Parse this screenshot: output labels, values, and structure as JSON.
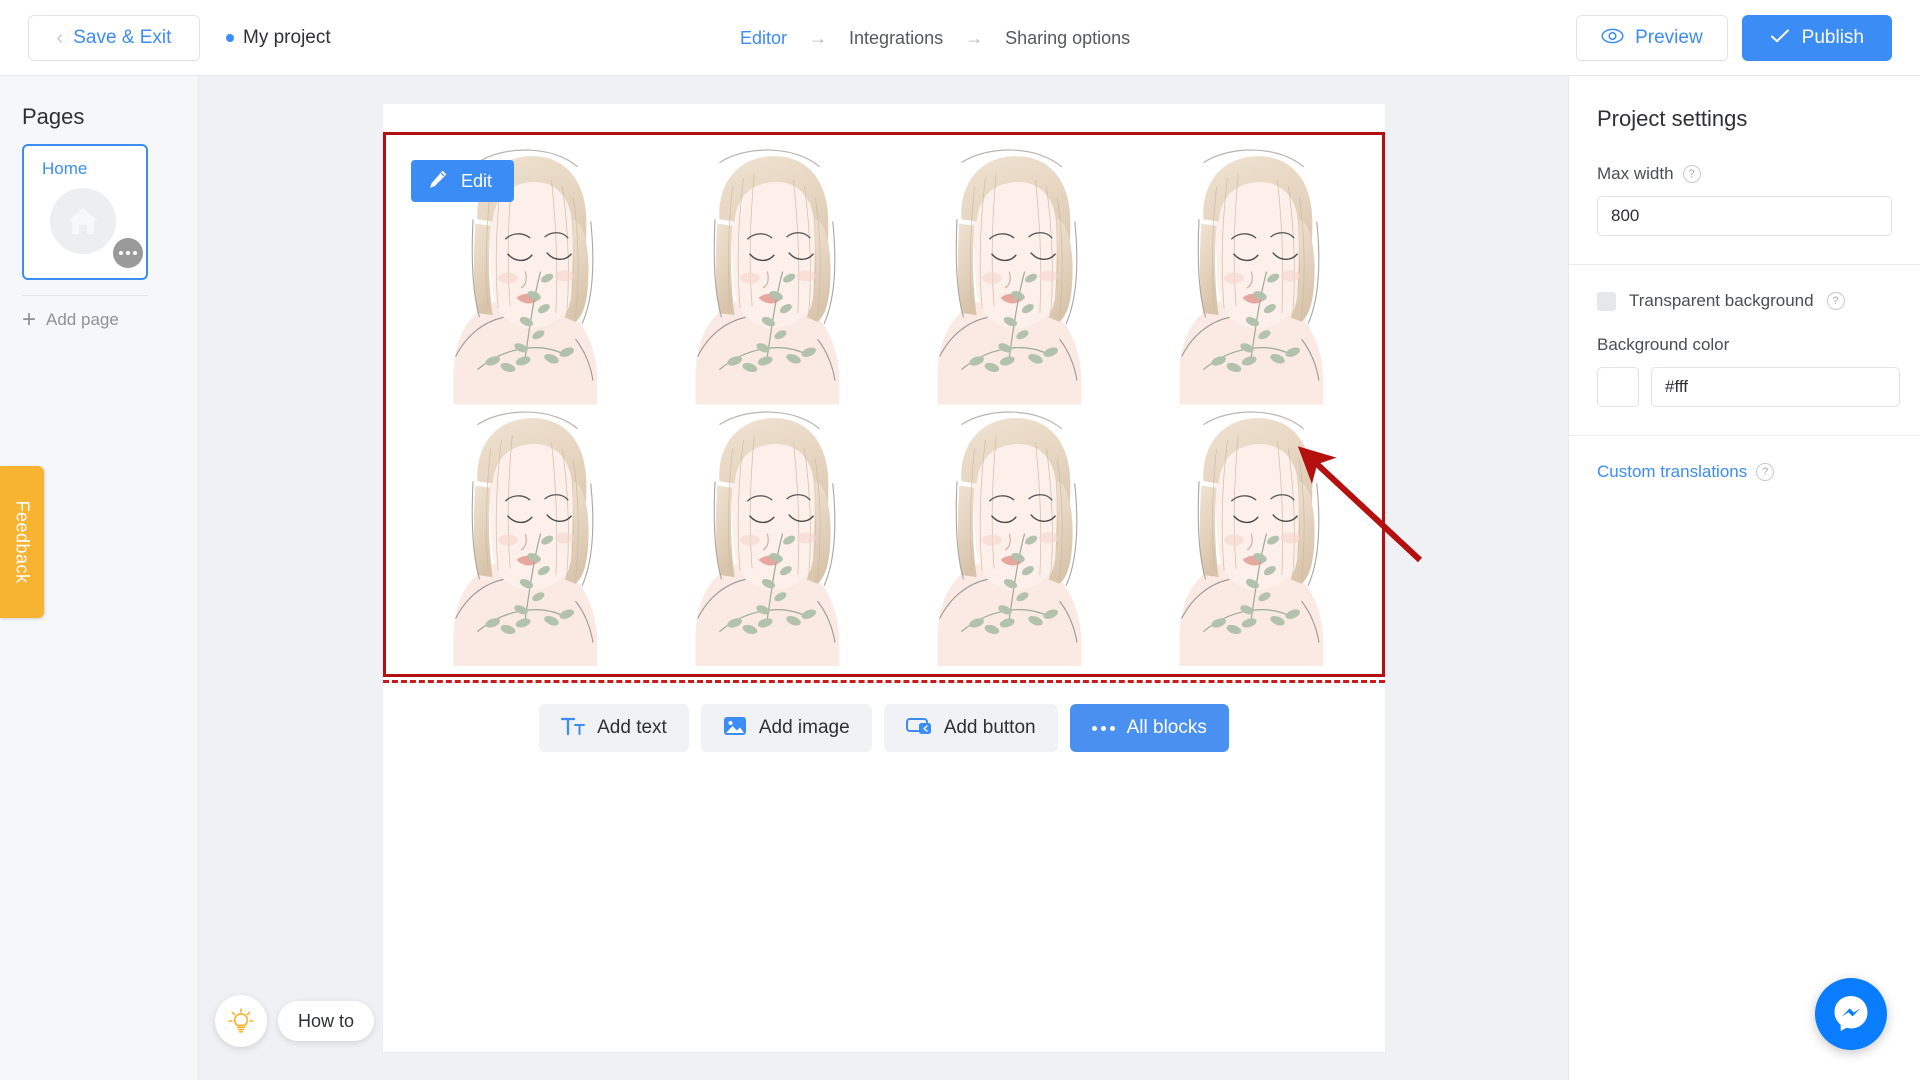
{
  "topbar": {
    "save_exit_label": "Save & Exit",
    "back_icon": "chevron-left-icon",
    "project_name": "My project",
    "status_dot_color": "#3b8cf5",
    "breadcrumb": [
      {
        "label": "Editor",
        "active": true
      },
      {
        "label": "Integrations",
        "active": false
      },
      {
        "label": "Sharing options",
        "active": false
      }
    ],
    "breadcrumb_separator": "→",
    "preview_label": "Preview",
    "preview_icon": "eye-icon",
    "publish_label": "Publish",
    "publish_icon": "check-icon",
    "publish_color": "#3b8cf5"
  },
  "sidebar": {
    "title": "Pages",
    "page_card": {
      "label": "Home",
      "thumb_icon": "home-icon",
      "menu_icon": "more-dots-icon",
      "selected": true
    },
    "add_page_label": "Add page",
    "add_page_icon": "plus-icon",
    "feedback_label": "Feedback",
    "feedback_color": "#f7b433"
  },
  "settings": {
    "title": "Project settings",
    "max_width_label": "Max width",
    "max_width_value": "800",
    "max_width_placeholder": "800",
    "help_icon": "question-mark-icon",
    "transparent_background_label": "Transparent background",
    "transparent_background_checked": false,
    "background_color_label": "Background color",
    "background_color_value": "#fff",
    "background_color_placeholder": "#fff",
    "background_swatch_color": "#ffffff",
    "custom_translations_label": "Custom translations"
  },
  "canvas": {
    "edit_label": "Edit",
    "edit_icon": "pencil-icon",
    "selection_border_color": "#b51010",
    "image_alt": "line-art-woman-illustration",
    "image_count": 8,
    "annotation_arrow_color": "#b51010"
  },
  "add_toolbar": {
    "buttons": [
      {
        "label": "Add text",
        "icon": "text-icon",
        "primary": false
      },
      {
        "label": "Add image",
        "icon": "image-icon",
        "primary": false
      },
      {
        "label": "Add button",
        "icon": "button-icon",
        "primary": false
      },
      {
        "label": "All blocks",
        "icon": "dots-icon",
        "primary": true
      }
    ]
  },
  "howto": {
    "label": "How to",
    "icon": "lightbulb-icon",
    "icon_color": "#f7b433"
  },
  "messenger": {
    "icon": "messenger-icon",
    "color": "#0a7cff"
  }
}
